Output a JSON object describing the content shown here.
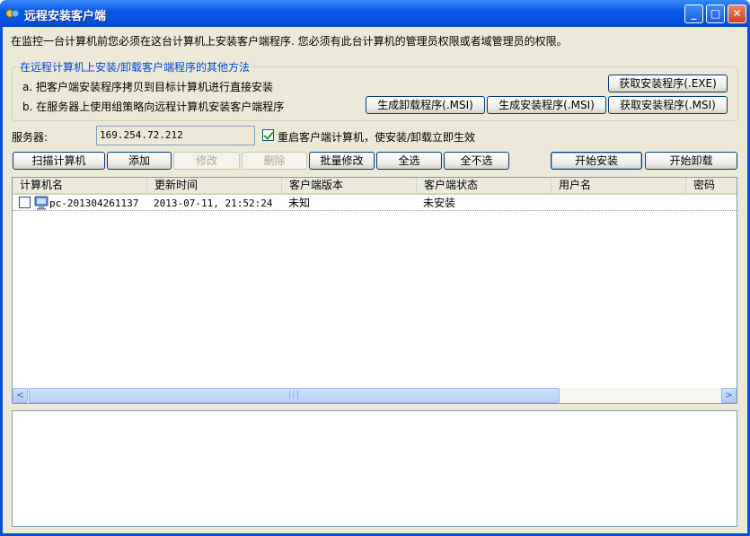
{
  "window": {
    "title": "远程安装客户端",
    "minimize": "_",
    "maximize": "□",
    "close": "✕"
  },
  "notice": "在监控一台计算机前您必须在这台计算机上安装客户端程序. 您必须有此台计算机的管理员权限或者域管理员的权限。",
  "other_methods": {
    "legend": "在远程计算机上安装/卸载客户端程序的其他方法",
    "item_a": "a. 把客户端安装程序拷贝到目标计算机进行直接安装",
    "item_b": "b. 在服务器上使用组策略向远程计算机安装客户端程序",
    "get_exe": "获取安装程序(.EXE)",
    "gen_uninstall_msi": "生成卸载程序(.MSI)",
    "gen_install_msi": "生成安装程序(.MSI)",
    "get_msi": "获取安装程序(.MSI)"
  },
  "server": {
    "label": "服务器:",
    "value": "169.254.72.212",
    "restart_label": "重启客户端计算机，使安装/卸载立即生效",
    "restart_checked": true
  },
  "toolbar": {
    "scan": "扫描计算机",
    "add": "添加",
    "edit": "修改",
    "delete": "删除",
    "batch_edit": "批量修改",
    "select_all": "全选",
    "select_none": "全不选",
    "start_install": "开始安装",
    "start_uninstall": "开始卸载"
  },
  "table": {
    "columns": [
      "计算机名",
      "更新时间",
      "客户端版本",
      "客户端状态",
      "用户名",
      "密码"
    ],
    "rows": [
      {
        "name": "pc-201304261137",
        "time": "2013-07-11, 21:52:24",
        "version": "未知",
        "status": "未安装",
        "user": "",
        "password": "",
        "checked": false
      }
    ]
  },
  "scroll": {
    "left": "<",
    "right": ">",
    "grip": "|||"
  },
  "colors": {
    "titlebar": "#0a5ae8",
    "face": "#ece9d8",
    "legend": "#0046d5"
  },
  "icons": {
    "app": "app-icon",
    "computer": "computer-icon"
  }
}
